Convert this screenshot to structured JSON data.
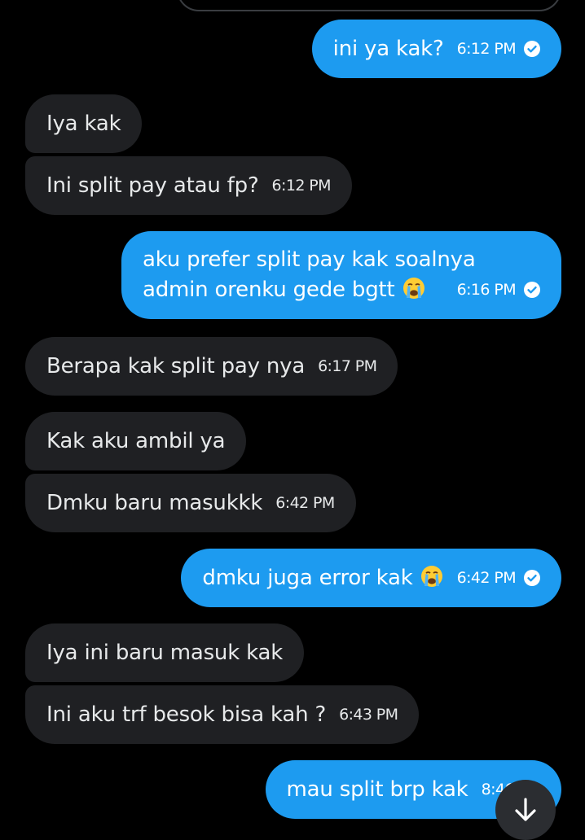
{
  "colors": {
    "outgoing_bubble": "#1d9bf0",
    "incoming_bubble": "#1f2023",
    "background": "#000000"
  },
  "messages": [
    {
      "dir": "out",
      "text": "ini ya kak?",
      "time": "6:12 PM",
      "read": true
    },
    {
      "dir": "in",
      "text": "Iya kak"
    },
    {
      "dir": "in",
      "text": "Ini split pay atau fp?",
      "time": "6:12 PM"
    },
    {
      "dir": "out",
      "line1": "aku prefer split pay kak soalnya",
      "line2": "admin orenku gede bgtt",
      "emoji": "loudly-crying-face-icon",
      "time": "6:16 PM",
      "read": true
    },
    {
      "dir": "in",
      "text": "Berapa kak split pay nya",
      "time": "6:17 PM"
    },
    {
      "dir": "in",
      "text": "Kak aku ambil ya"
    },
    {
      "dir": "in",
      "text": "Dmku baru masukkk",
      "time": "6:42 PM"
    },
    {
      "dir": "out",
      "text": "dmku juga error kak",
      "emoji": "loudly-crying-face-icon",
      "time": "6:42 PM",
      "read": true
    },
    {
      "dir": "in",
      "text": "Iya ini baru masuk kak"
    },
    {
      "dir": "in",
      "text": "Ini aku trf besok bisa kah ?",
      "time": "6:43 PM"
    },
    {
      "dir": "out",
      "text": "mau split brp kak",
      "time": "8:46 PM"
    }
  ],
  "scroll_button": {
    "icon": "arrow-down-icon"
  }
}
